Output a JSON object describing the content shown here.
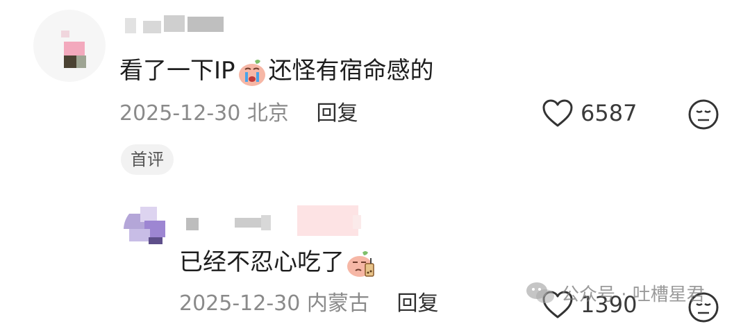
{
  "comments": [
    {
      "text_before": "看了一下IP",
      "text_after": "还怪有宿命感的",
      "date": "2025-12-30",
      "location": "北京",
      "reply_label": "回复",
      "likes": "6587",
      "badge": "首评",
      "emoji_name": "crying-face-emoji"
    },
    {
      "text": "已经不忍心吃了",
      "date": "2025-12-30",
      "location": "内蒙古",
      "reply_label": "回复",
      "likes": "1390",
      "emoji_name": "bubble-tea-sad-emoji"
    }
  ],
  "watermark": {
    "text": "公众号 · 吐槽星君",
    "icon": "wechat-icon"
  },
  "colors": {
    "text": "#1e1e1e",
    "meta": "#8a8a8a",
    "badge_bg": "#f2f2f2"
  }
}
